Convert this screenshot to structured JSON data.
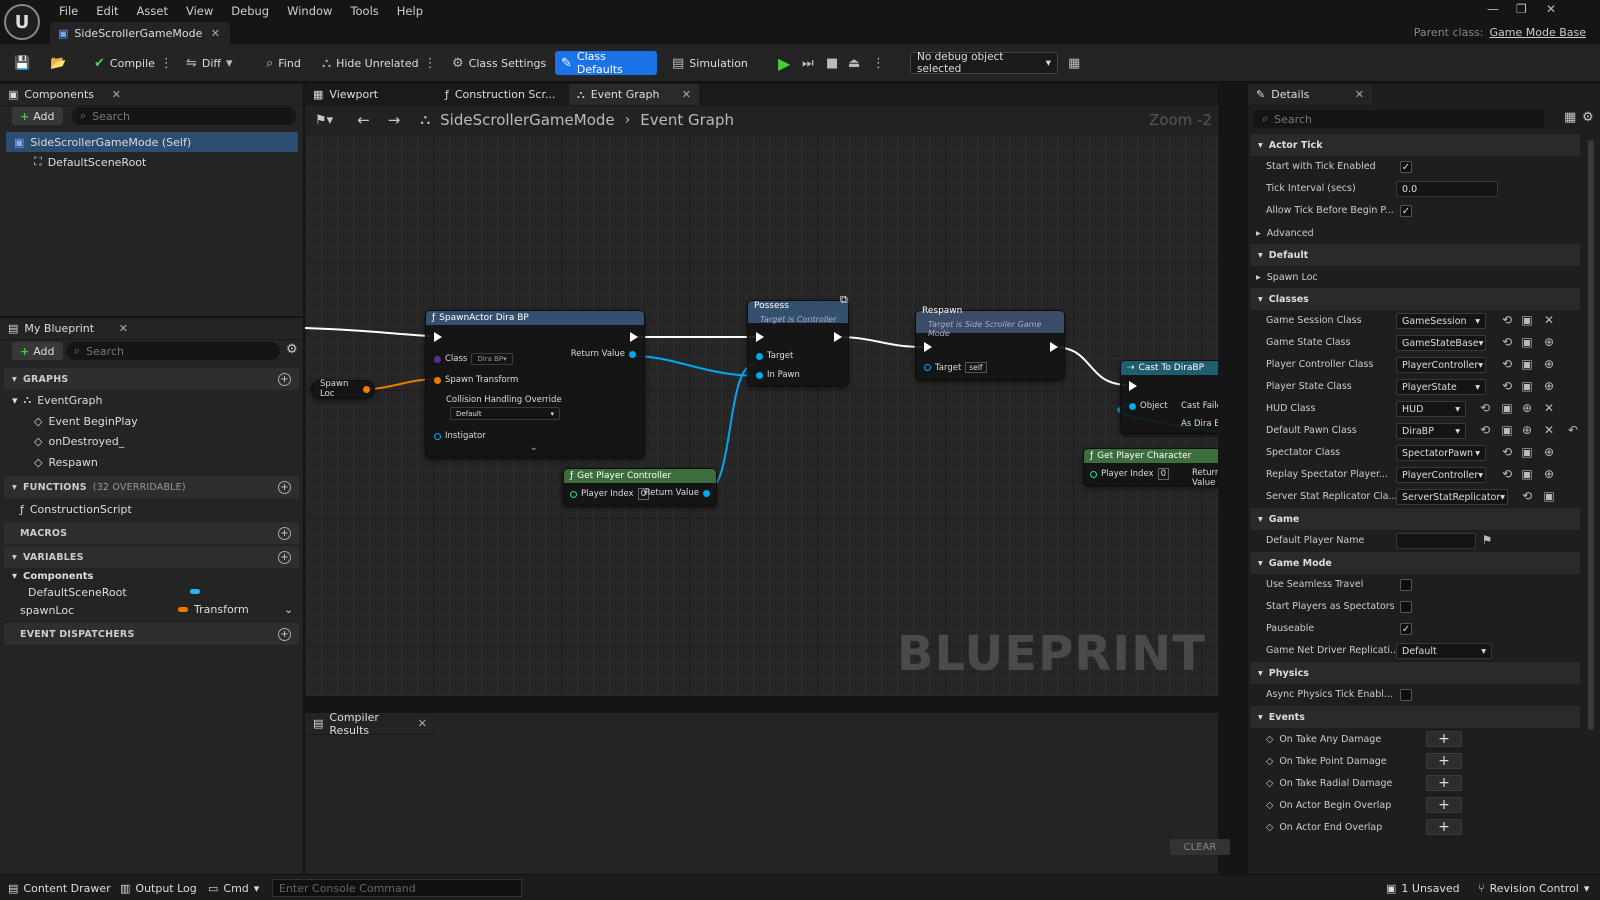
{
  "app": {
    "logo": "unreal-engine-logo",
    "menu": [
      "File",
      "Edit",
      "Asset",
      "View",
      "Debug",
      "Window",
      "Tools",
      "Help"
    ],
    "doc_tab": "SideScrollerGameMode",
    "parent_label": "Parent class:",
    "parent_value": "Game Mode Base"
  },
  "toolbar": {
    "compile": "Compile",
    "diff": "Diff",
    "find": "Find",
    "hide_unrelated": "Hide Unrelated",
    "class_settings": "Class Settings",
    "class_defaults": "Class Defaults",
    "simulation": "Simulation",
    "debug_object": "No debug object selected"
  },
  "components": {
    "tab": "Components",
    "add": "Add",
    "search_placeholder": "Search",
    "self_item": "SideScrollerGameMode (Self)",
    "root_item": "DefaultSceneRoot"
  },
  "my_blueprint": {
    "tab": "My Blueprint",
    "add": "Add",
    "search_placeholder": "Search",
    "graphs_header": "GRAPHS",
    "event_graph": "EventGraph",
    "events": [
      "Event BeginPlay",
      "onDestroyed_",
      "Respawn"
    ],
    "functions_header": "FUNCTIONS",
    "functions_note": "(32 OVERRIDABLE)",
    "construction_script": "ConstructionScript",
    "macros_header": "MACROS",
    "variables_header": "VARIABLES",
    "components_group": "Components",
    "var_default_root": "DefaultSceneRoot",
    "var_spawnloc": "spawnLoc",
    "var_spawnloc_type": "Transform",
    "dispatchers_header": "EVENT DISPATCHERS"
  },
  "editor_tabs": {
    "viewport": "Viewport",
    "construction": "Construction Scr...",
    "event_graph": "Event Graph"
  },
  "graph": {
    "breadcrumb_root": "SideScrollerGameMode",
    "breadcrumb_leaf": "Event Graph",
    "zoom": "Zoom -2",
    "watermark": "BLUEPRINT",
    "spawn_loc": "Spawn Loc",
    "spawn_actor": {
      "title": "SpawnActor Dira BP",
      "class": "Class",
      "class_value": "Dira BP",
      "return": "Return Value",
      "transform": "Spawn Transform",
      "collision": "Collision Handling Override",
      "collision_value": "Default",
      "instigator": "Instigator"
    },
    "possess": {
      "title": "Possess",
      "subtitle": "Target is Controller",
      "target": "Target",
      "in_pawn": "In Pawn"
    },
    "respawn": {
      "title": "Respawn",
      "subtitle": "Target is Side Scroller Game Mode",
      "target": "Target",
      "target_value": "self"
    },
    "cast": {
      "title": "Cast To DiraBP",
      "object": "Object",
      "cast_failed": "Cast Failed",
      "as_dira": "As Dira BP"
    },
    "get_pc": {
      "title": "Get Player Controller",
      "index": "Player Index",
      "index_value": "0",
      "return": "Return Value"
    },
    "get_char": {
      "title": "Get Player Character",
      "index": "Player Index",
      "index_value": "0",
      "return": "Return Value"
    }
  },
  "compiler": {
    "tab": "Compiler Results",
    "clear": "CLEAR"
  },
  "details": {
    "tab": "Details",
    "search_placeholder": "Search",
    "actor_tick": "Actor Tick",
    "start_tick": "Start with Tick Enabled",
    "tick_interval": "Tick Interval (secs)",
    "tick_interval_value": "0.0",
    "allow_tick": "Allow Tick Before Begin P...",
    "advanced": "Advanced",
    "default": "Default",
    "spawn_loc": "Spawn Loc",
    "classes": "Classes",
    "class_rows": [
      {
        "label": "Game Session Class",
        "value": "GameSession"
      },
      {
        "label": "Game State Class",
        "value": "GameStateBase"
      },
      {
        "label": "Player Controller Class",
        "value": "PlayerController"
      },
      {
        "label": "Player State Class",
        "value": "PlayerState"
      },
      {
        "label": "HUD Class",
        "value": "HUD"
      },
      {
        "label": "Default Pawn Class",
        "value": "DiraBP"
      },
      {
        "label": "Spectator Class",
        "value": "SpectatorPawn"
      },
      {
        "label": "Replay Spectator Player...",
        "value": "PlayerController"
      },
      {
        "label": "Server Stat Replicator Cla...",
        "value": "ServerStatReplicator"
      }
    ],
    "game": "Game",
    "default_player_name": "Default Player Name",
    "game_mode": "Game Mode",
    "seamless": "Use Seamless Travel",
    "spectators": "Start Players as Spectators",
    "pauseable": "Pauseable",
    "net_driver": "Game Net Driver Replicati...",
    "net_driver_value": "Default",
    "physics": "Physics",
    "async_physics": "Async Physics Tick Enabl...",
    "events": "Events",
    "event_rows": [
      "On Take Any Damage",
      "On Take Point Damage",
      "On Take Radial Damage",
      "On Actor Begin Overlap",
      "On Actor End Overlap"
    ]
  },
  "status": {
    "content_drawer": "Content Drawer",
    "output_log": "Output Log",
    "cmd": "Cmd",
    "console_placeholder": "Enter Console Command",
    "unsaved": "1 Unsaved",
    "revision": "Revision Control"
  },
  "colors": {
    "accent": "#1a73e8",
    "exec_wire": "#ffffff",
    "object_pin": "#00a8f0",
    "struct_pin": "#f07800",
    "func_head": "#3c6e3c",
    "call_head": "#34506e",
    "cast_head": "#1f5e6e"
  }
}
